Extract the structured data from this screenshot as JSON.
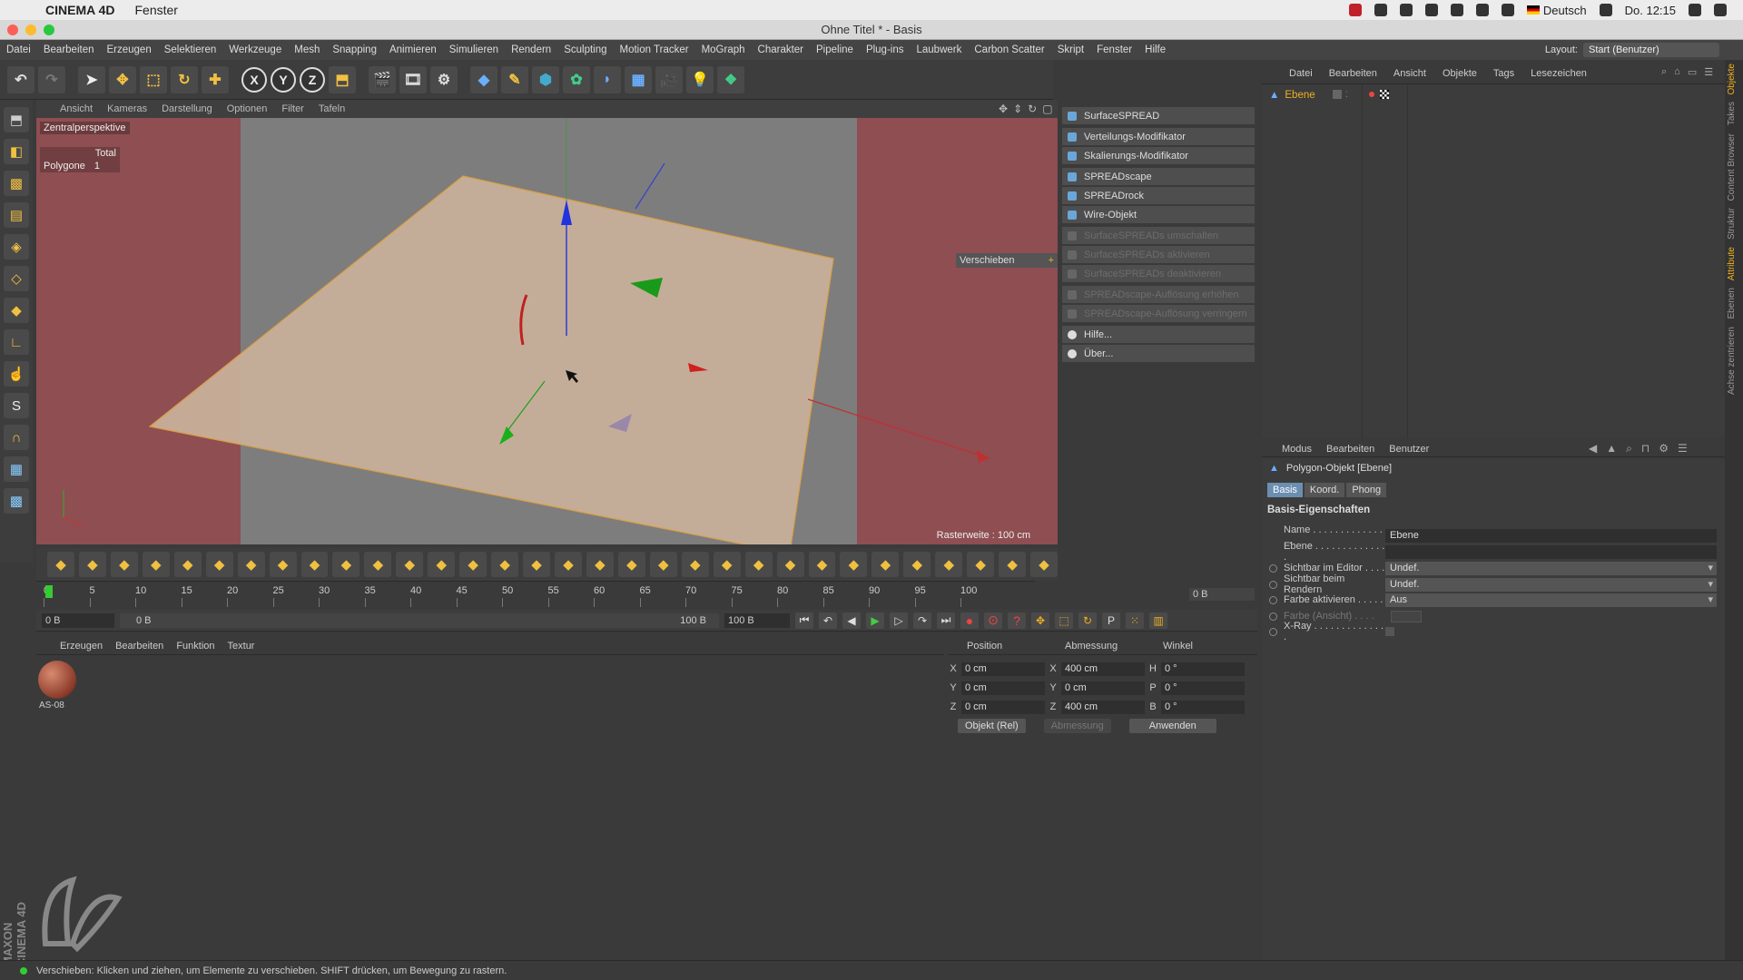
{
  "macbar": {
    "app_name": "CINEMA 4D",
    "menu_fenster": "Fenster",
    "language": "Deutsch",
    "clock": "Do. 12:15"
  },
  "window": {
    "title": "Ohne Titel * - Basis"
  },
  "menu": [
    "Datei",
    "Bearbeiten",
    "Erzeugen",
    "Selektieren",
    "Werkzeuge",
    "Mesh",
    "Snapping",
    "Animieren",
    "Simulieren",
    "Rendern",
    "Sculpting",
    "Motion Tracker",
    "MoGraph",
    "Charakter",
    "Pipeline",
    "Plug-ins",
    "Laubwerk",
    "Carbon Scatter",
    "Skript",
    "Fenster",
    "Hilfe"
  ],
  "layout": {
    "label": "Layout:",
    "value": "Start (Benutzer)"
  },
  "toolbar": {
    "axis_x": "X",
    "axis_y": "Y",
    "axis_z": "Z"
  },
  "viewport": {
    "menu": [
      "Ansicht",
      "Kameras",
      "Darstellung",
      "Optionen",
      "Filter",
      "Tafeln"
    ],
    "camera": "Zentralperspektive",
    "stats_header": "Total",
    "stats_label": "Polygone",
    "stats_value": "1",
    "grid_info": "Rasterweite : 100 cm",
    "tool_label": "Verschieben"
  },
  "spread_menu": {
    "group1": [
      "SurfaceSPREAD"
    ],
    "group2": [
      "Verteilungs-Modifikator",
      "Skalierungs-Modifikator"
    ],
    "group3": [
      "SPREADscape",
      "SPREADrock",
      "Wire-Objekt"
    ],
    "group4": [
      "SurfaceSPREADs umschalten",
      "SurfaceSPREADs aktivieren",
      "SurfaceSPREADs deaktivieren"
    ],
    "group5": [
      "SPREADscape-Auflösung erhöhen",
      "SPREADscape-Auflösung verringern"
    ],
    "group6": [
      "Hilfe...",
      "Über..."
    ]
  },
  "object_manager": {
    "menu": [
      "Datei",
      "Bearbeiten",
      "Ansicht",
      "Objekte",
      "Tags",
      "Lesezeichen"
    ],
    "object_name": "Ebene"
  },
  "side_tabs": [
    "Objekte",
    "Takes",
    "Content Browser",
    "Struktur",
    "Attribute",
    "Ebenen",
    "Achse zentrieren"
  ],
  "attributes": {
    "menu": [
      "Modus",
      "Bearbeiten",
      "Benutzer"
    ],
    "title": "Polygon-Objekt [Ebene]",
    "tabs": [
      "Basis",
      "Koord.",
      "Phong"
    ],
    "section": "Basis-Eigenschaften",
    "rows": [
      {
        "label": "Name . . . . . . . . . . . . . . .",
        "value": "Ebene"
      },
      {
        "label": "Ebene . . . . . . . . . . . . . .",
        "value": ""
      },
      {
        "label": "Sichtbar im Editor . . . .",
        "value": "Undef."
      },
      {
        "label": "Sichtbar beim Rendern",
        "value": "Undef."
      },
      {
        "label": "Farbe aktivieren . . . . .",
        "value": "Aus"
      },
      {
        "label": "Farbe (Ansicht) . . . .",
        "value": ""
      },
      {
        "label": "X-Ray . . . . . . . . . . . . . .",
        "value": ""
      }
    ]
  },
  "timeline": {
    "ticks": [
      "0",
      "5",
      "10",
      "15",
      "20",
      "25",
      "30",
      "35",
      "40",
      "45",
      "50",
      "55",
      "60",
      "65",
      "70",
      "75",
      "80",
      "85",
      "90",
      "95",
      "100"
    ],
    "frame_end": "0 B"
  },
  "transport": {
    "current": "0 B",
    "range_start": "0 B",
    "range_end": "100 B",
    "end": "100 B"
  },
  "material_manager": {
    "menu": [
      "Erzeugen",
      "Bearbeiten",
      "Funktion",
      "Textur"
    ],
    "material_name": "AS-08"
  },
  "coordinates": {
    "headers": [
      "Position",
      "Abmessung",
      "Winkel"
    ],
    "rows": [
      {
        "axis": "X",
        "pos": "0 cm",
        "size_axis": "X",
        "size": "400 cm",
        "rot_axis": "H",
        "rot": "0 °"
      },
      {
        "axis": "Y",
        "pos": "0 cm",
        "size_axis": "Y",
        "size": "0 cm",
        "rot_axis": "P",
        "rot": "0 °"
      },
      {
        "axis": "Z",
        "pos": "0 cm",
        "size_axis": "Z",
        "size": "400 cm",
        "rot_axis": "B",
        "rot": "0 °"
      }
    ],
    "mode": "Objekt (Rel)",
    "size_mode": "Abmessung",
    "apply": "Anwenden"
  },
  "status": {
    "text": "Verschieben: Klicken und ziehen, um Elemente zu verschieben. SHIFT drücken, um Bewegung zu rastern."
  },
  "logo": {
    "text": "MAXON CINEMA 4D"
  },
  "colors": {
    "accent": "#f0b020",
    "viewport_bg": "#7a7a7a",
    "plane": "#c8b09a",
    "outside_render": "#8e4e52"
  }
}
